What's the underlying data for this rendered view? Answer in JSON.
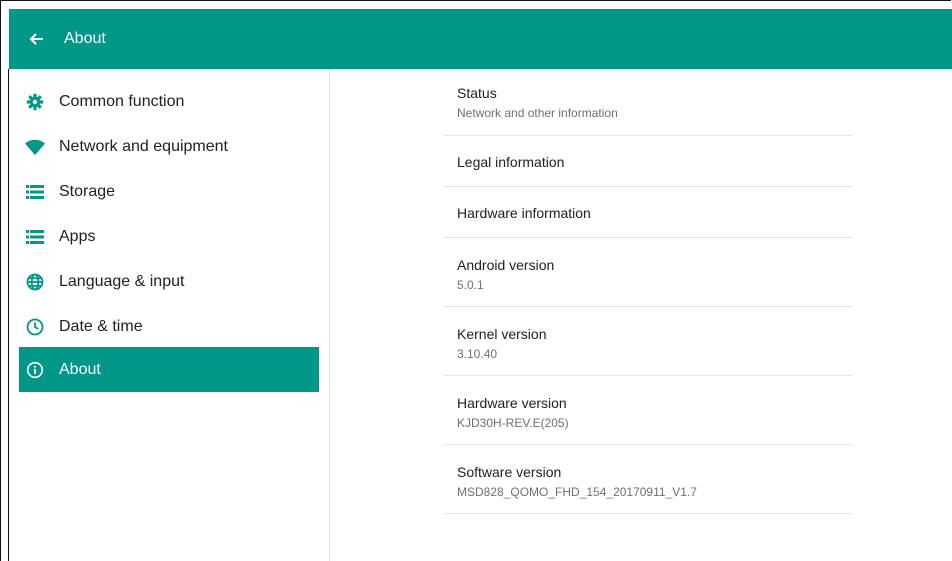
{
  "header": {
    "title": "About"
  },
  "sidebar": {
    "items": [
      {
        "label": "Common function",
        "icon": "gear-icon"
      },
      {
        "label": "Network and equipment",
        "icon": "wifi-icon"
      },
      {
        "label": "Storage",
        "icon": "list-icon"
      },
      {
        "label": "Apps",
        "icon": "list-icon"
      },
      {
        "label": "Language & input",
        "icon": "globe-icon"
      },
      {
        "label": "Date & time",
        "icon": "clock-icon"
      },
      {
        "label": "About",
        "icon": "info-icon",
        "active": true
      }
    ]
  },
  "main": {
    "rows": [
      {
        "title": "Status",
        "summary": "Network and other information"
      },
      {
        "title": "Legal information"
      },
      {
        "title": "Hardware information"
      },
      {
        "title": "Android version",
        "summary": "5.0.1"
      },
      {
        "title": "Kernel version",
        "summary": "3.10.40"
      },
      {
        "title": "Hardware version",
        "summary": "KJD30H-REV.E(205)"
      },
      {
        "title": "Software version",
        "summary": "MSD828_QOMO_FHD_154_20170911_V1.7"
      }
    ]
  },
  "colors": {
    "accent": "#009688",
    "text": "#212121",
    "secondary": "#6f6f6f"
  }
}
